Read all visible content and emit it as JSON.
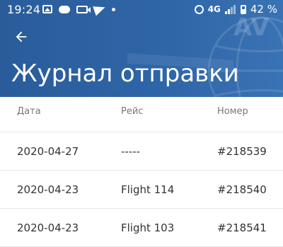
{
  "status_bar": {
    "time": "19:24",
    "network": "4G",
    "battery": "42 %",
    "icons": [
      "image-icon",
      "game-icon",
      "video-icon",
      "telegram-icon",
      "dot-icon",
      "alarm-icon",
      "signal-icon",
      "battery-icon"
    ]
  },
  "header": {
    "title": "Журнал отправки",
    "back_icon": "arrow-left-icon",
    "background_color": "#2f66a8"
  },
  "table": {
    "columns": [
      "Дата",
      "Рейс",
      "Номер"
    ],
    "rows": [
      [
        "2020-04-27",
        "-----",
        "#218539"
      ],
      [
        "2020-04-23",
        "Flight 114",
        "#218540"
      ],
      [
        "2020-04-23",
        "Flight 103",
        "#218541"
      ]
    ]
  }
}
